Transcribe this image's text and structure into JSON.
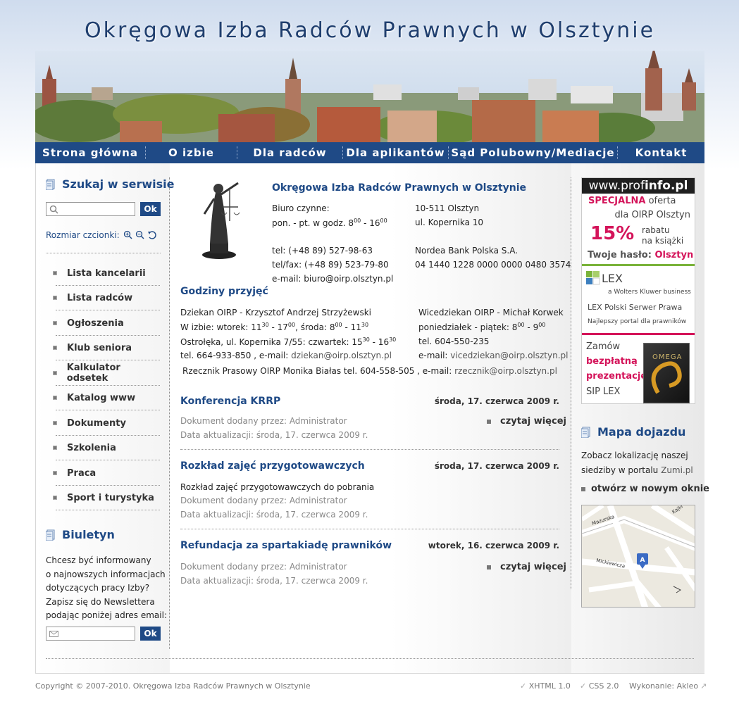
{
  "site": {
    "title": "Okręgowa Izba Radców Prawnych w Olsztynie"
  },
  "nav": [
    "Strona główna",
    "O izbie",
    "Dla radców",
    "Dla aplikantów",
    "Sąd Polubowny/Mediacje",
    "Kontakt"
  ],
  "left": {
    "search_title": "Szukaj w serwisie",
    "search_button": "Ok",
    "font_size_label": "Rozmiar czcionki:",
    "menu": [
      "Lista kancelarii",
      "Lista radców",
      "Ogłoszenia",
      "Klub seniora",
      "Kalkulator odsetek",
      "Katalog www",
      "Dokumenty",
      "Szkolenia",
      "Praca",
      "Sport i turystyka"
    ],
    "newsletter_title": "Biuletyn",
    "newsletter_text": [
      "Chcesz być informowany",
      "o najnowszych informacjach",
      "dotyczących pracy Izby?",
      "Zapisz się do Newslettera",
      "podając poniżej adres email:"
    ],
    "newsletter_button": "Ok"
  },
  "info": {
    "heading": "Okręgowa Izba Radców Prawnych w Olsztynie",
    "office_label": "Biuro czynne:",
    "hours_prefix": "pon. - pt. w godz. 8",
    "hours_from_sup": "00",
    "hours_mid": " - 16",
    "hours_to_sup": "00",
    "phone": "tel: (+48 89) 527-98-63",
    "fax": "tel/fax: (+48 89) 523-79-80",
    "email": "e-mail: biuro@oirp.olsztyn.pl",
    "postcode": "10-511 Olsztyn",
    "street": "ul. Kopernika 10",
    "bank": "Nordea Bank Polska S.A.",
    "account": "04 1440 1228 0000 0000 0480 3574"
  },
  "hours": {
    "title": "Godziny przyjęć",
    "dean": "Dziekan OIRP - Krzysztof Andrzej Strzyżewski",
    "dean_l2_a": "W izbie: wtorek: 11",
    "dean_l2_s1": "30",
    "dean_l2_b": " - 17",
    "dean_l2_s2": "00",
    "dean_l2_c": ", środa: 8",
    "dean_l2_s3": "00",
    "dean_l2_d": " - 11",
    "dean_l2_s4": "30",
    "dean_l3_a": "Ostrołęka, ul. Kopernika 7/55: czwartek: 15",
    "dean_l3_s1": "30",
    "dean_l3_b": " - 16",
    "dean_l3_s2": "30",
    "dean_l4_a": "tel. 664-933-850 , e-mail: ",
    "dean_email": "dziekan@oirp.olsztyn.pl",
    "vice": "Wicedziekan OIRP - Michał Korwek",
    "vice_l2_a": "poniedziałek - piątek: 8",
    "vice_l2_s1": "00",
    "vice_l2_b": " - 9",
    "vice_l2_s2": "00",
    "vice_phone": "tel. 604-550-235",
    "vice_l4_a": "e-mail: ",
    "vice_email": "vicedziekan@oirp.olsztyn.pl",
    "press_a": "Rzecznik Prasowy OIRP Monika Białas tel. 604-558-505 , e-mail: ",
    "press_email": "rzecznik@oirp.olsztyn.pl"
  },
  "articles": [
    {
      "title": "Konferencja KRRP",
      "date": "środa, 17. czerwca 2009 r.",
      "body": "",
      "added_label": "Dokument dodany przez: ",
      "added_by": "Administrator",
      "updated": "Data aktualizacji: środa, 17. czerwca 2009 r.",
      "more": "czytaj więcej"
    },
    {
      "title": "Rozkład zajęć przygotowawczych",
      "date": "środa, 17. czerwca 2009 r.",
      "body": "Rozkład zajęć przygotowawczych do pobrania",
      "added_label": "Dokument dodany przez: ",
      "added_by": "Administrator",
      "updated": "Data aktualizacji: środa, 17. czerwca 2009 r.",
      "more": ""
    },
    {
      "title": "Refundacja za spartakiadę prawników",
      "date": "wtorek, 16. czerwca 2009 r.",
      "body": "",
      "added_label": "Dokument dodany przez: ",
      "added_by": "Administrator",
      "updated": "Data aktualizacji: środa, 17. czerwca 2009 r.",
      "more": "czytaj więcej"
    }
  ],
  "ads": {
    "profinfo_logo_a": "www.prof",
    "profinfo_logo_b": "info.pl",
    "special_a": "SPECJALNA",
    "special_b": " oferta",
    "for": "dla OIRP Olsztyn",
    "percent": "15%",
    "discount_a": "rabatu",
    "discount_b": "na książki",
    "password_a": "Twoje hasło: ",
    "password_b": "Olsztyn",
    "lex_logo": "LEX",
    "lex_sub": "a Wolters Kluwer business",
    "lex_server": "LEX Polski Serwer Prawa",
    "lex_portal": "Najlepszy portal dla prawników",
    "order": "Zamów",
    "free_a": "bezpłatną",
    "free_b": "prezentację",
    "sip": "SIP LEX",
    "box_label": "OMEGA"
  },
  "map": {
    "title": "Mapa dojazdu",
    "text_a": "Zobacz lokalizację naszej",
    "text_b": "siedziby w portalu ",
    "text_link": "Zumi.pl",
    "open": "otwórz w nowym oknie",
    "street1": "Mazurska",
    "street2": "Mickiewicza",
    "street3": "Kajki",
    "marker": "A"
  },
  "footer": {
    "copyright": "Copyright © 2007-2010. Okręgowa Izba Radców Prawnych w Olsztynie",
    "xhtml": "XHTML 1.0",
    "css": "CSS 2.0",
    "made_by": "Wykonanie: Akleo"
  },
  "colors": {
    "brand": "#1f4a86",
    "accent_pink": "#d4145a",
    "lex_green": "#6aa033"
  }
}
